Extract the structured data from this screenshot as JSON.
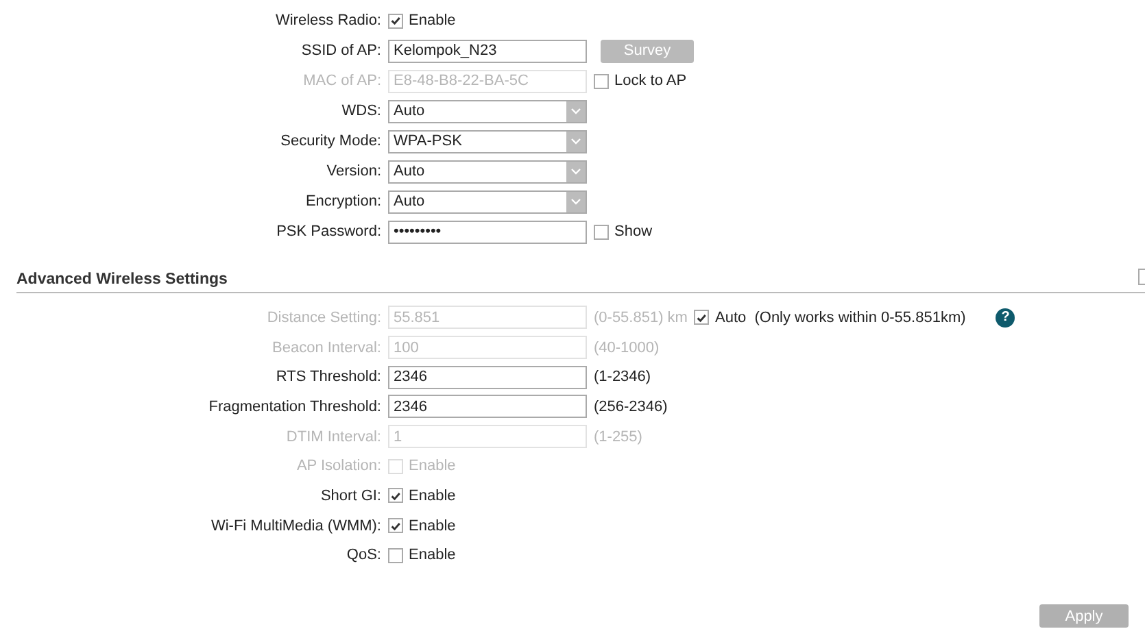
{
  "wireless": [
    {
      "label": "Wireless Radio:",
      "kind": "checkbox",
      "checked": true,
      "text": "Enable",
      "disabled": false
    },
    {
      "label": "SSID of AP:",
      "kind": "text",
      "value": "Kelompok_N23",
      "disabled": false,
      "after": [
        {
          "kind": "button",
          "text": "Survey"
        }
      ]
    },
    {
      "label": "MAC of AP:",
      "kind": "text",
      "value": "E8-48-B8-22-BA-5C",
      "disabled": true,
      "after": [
        {
          "kind": "checkbox",
          "text": "Lock to AP",
          "checked": false
        }
      ]
    },
    {
      "label": "WDS:",
      "kind": "select",
      "value": "Auto",
      "disabled": false
    },
    {
      "label": "Security Mode:",
      "kind": "select",
      "value": "WPA-PSK",
      "disabled": false
    },
    {
      "label": "Version:",
      "kind": "select",
      "value": "Auto",
      "disabled": false
    },
    {
      "label": "Encryption:",
      "kind": "select",
      "value": "Auto",
      "disabled": false
    },
    {
      "label": "PSK Password:",
      "kind": "text",
      "value": "•••••••••",
      "disabled": false,
      "after": [
        {
          "kind": "checkbox",
          "text": "Show",
          "checked": false
        }
      ]
    }
  ],
  "advanced": {
    "title": "Advanced Wireless Settings",
    "edge_checkbox": {
      "checked": false
    },
    "rows": [
      {
        "label": "Distance Setting:",
        "kind": "text",
        "value": "55.851",
        "disabled": true,
        "after": [
          {
            "kind": "hint",
            "text": "(0-55.851) km"
          },
          {
            "kind": "checkbox",
            "text": "Auto  (Only works within 0-55.851km)",
            "checked": true
          },
          {
            "kind": "help",
            "text": "?"
          }
        ]
      },
      {
        "label": "Beacon Interval:",
        "kind": "text",
        "value": "100",
        "disabled": true,
        "after": [
          {
            "kind": "hint",
            "text": "(40-1000)"
          }
        ]
      },
      {
        "label": "RTS Threshold:",
        "kind": "text",
        "value": "2346",
        "disabled": false,
        "after": [
          {
            "kind": "hint",
            "text": "(1-2346)"
          }
        ]
      },
      {
        "label": "Fragmentation Threshold:",
        "kind": "text",
        "value": "2346",
        "disabled": false,
        "after": [
          {
            "kind": "hint",
            "text": "(256-2346)"
          }
        ]
      },
      {
        "label": "DTIM Interval:",
        "kind": "text",
        "value": "1",
        "disabled": true,
        "after": [
          {
            "kind": "hint",
            "text": "(1-255)"
          }
        ]
      },
      {
        "label": "AP Isolation:",
        "kind": "checkbox",
        "checked": false,
        "text": "Enable",
        "disabled": true
      },
      {
        "label": "Short GI:",
        "kind": "checkbox",
        "checked": true,
        "text": "Enable",
        "disabled": false
      },
      {
        "label": "Wi-Fi MultiMedia (WMM):",
        "kind": "checkbox",
        "checked": true,
        "text": "Enable",
        "disabled": false
      },
      {
        "label": "QoS:",
        "kind": "checkbox",
        "checked": false,
        "text": "Enable",
        "disabled": false
      }
    ]
  },
  "apply": "Apply"
}
